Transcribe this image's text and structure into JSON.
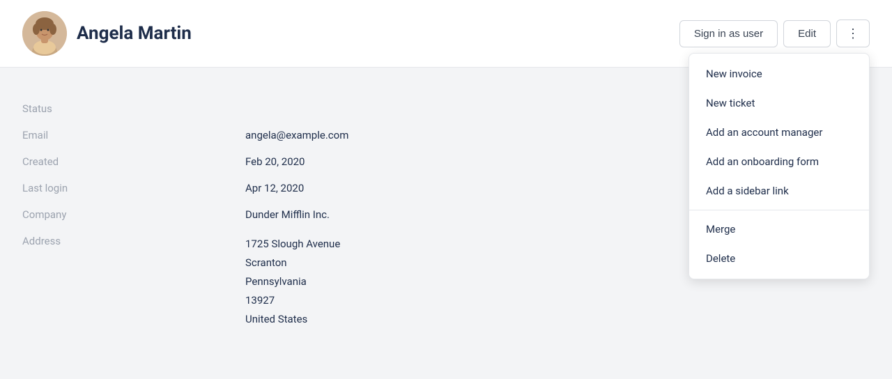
{
  "header": {
    "user_name": "Angela Martin",
    "sign_in_label": "Sign in as user",
    "edit_label": "Edit",
    "more_icon": "⋮"
  },
  "dropdown": {
    "items": [
      {
        "id": "new-invoice",
        "label": "New invoice",
        "section": 1
      },
      {
        "id": "new-ticket",
        "label": "New ticket",
        "section": 1
      },
      {
        "id": "add-account-manager",
        "label": "Add an account manager",
        "section": 1
      },
      {
        "id": "add-onboarding-form",
        "label": "Add an onboarding form",
        "section": 1
      },
      {
        "id": "add-sidebar-link",
        "label": "Add a sidebar link",
        "section": 1
      },
      {
        "id": "merge",
        "label": "Merge",
        "section": 2
      },
      {
        "id": "delete",
        "label": "Delete",
        "section": 2
      }
    ]
  },
  "profile": {
    "fields": [
      {
        "label": "Status",
        "value": ""
      },
      {
        "label": "Email",
        "value": "angela@example.com"
      },
      {
        "label": "Created",
        "value": "Feb 20, 2020"
      },
      {
        "label": "Last login",
        "value": "Apr 12, 2020"
      },
      {
        "label": "Company",
        "value": "Dunder Mifflin Inc."
      },
      {
        "label": "Address",
        "value": "1725 Slough Avenue\nScranton\nPennsylvania\n13927\nUnited States"
      }
    ]
  },
  "colors": {
    "accent": "#1e2d4a",
    "muted": "#9ca3af",
    "border": "#e5e7eb"
  }
}
